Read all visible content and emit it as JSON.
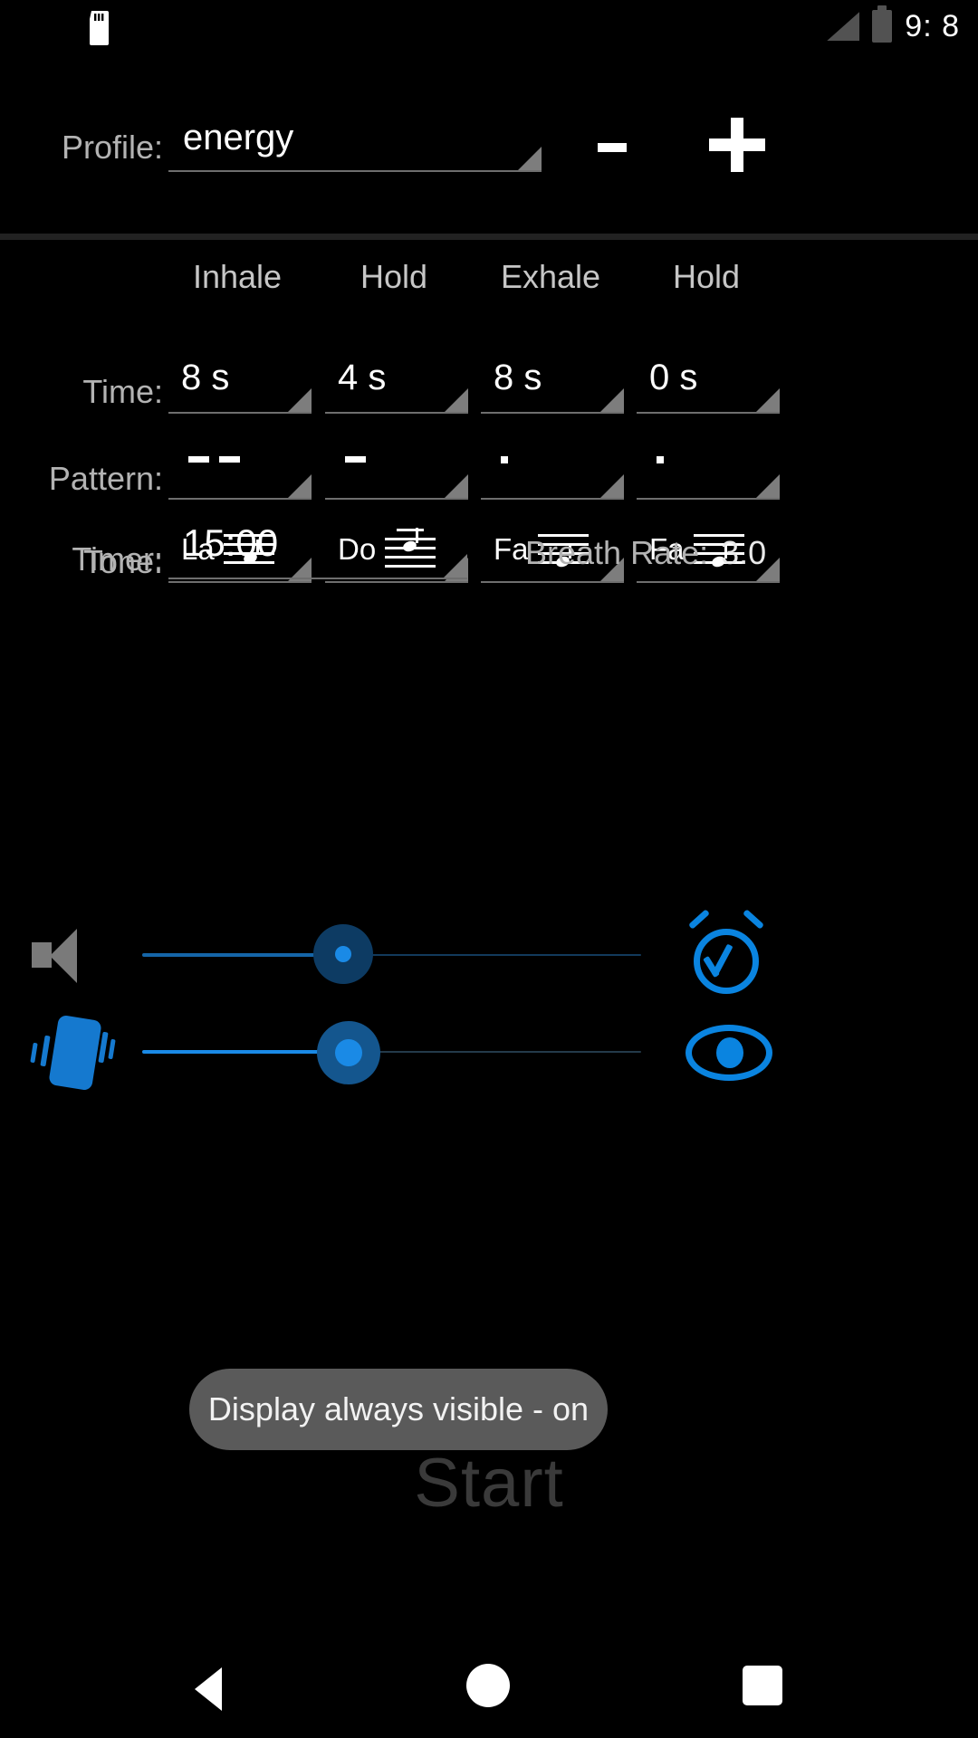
{
  "status_bar": {
    "sd_card_icon": "sd-card-icon",
    "signal_icon": "signal-bars-icon",
    "battery_icon": "battery-icon",
    "time": "9: 8"
  },
  "profile": {
    "label": "Profile:",
    "value": "energy",
    "dropdown_icon": "spinner-caret-icon",
    "minus_label": "−",
    "plus_label": "+",
    "minus_name": "remove-profile-button",
    "plus_name": "add-profile-button"
  },
  "table": {
    "columns": [
      "Inhale",
      "Hold",
      "Exhale",
      "Hold"
    ],
    "rows": [
      {
        "label": "Time:",
        "values": [
          "8 s",
          "4 s",
          "8 s",
          "0 s"
        ]
      },
      {
        "label": "Pattern:",
        "values": [
          "- -",
          "-",
          ".",
          "."
        ]
      },
      {
        "label": "Tone:",
        "values": [
          "La",
          "Do",
          "Fa",
          "Fa"
        ]
      }
    ]
  },
  "timer": {
    "label": "Timer:",
    "value": "15:00"
  },
  "breath_rate": {
    "label": "Breath Rate:",
    "value": "3.0"
  },
  "controls": {
    "volume": {
      "icon": "speaker-muted-icon",
      "slider_name": "volume-slider",
      "percent": 38,
      "end_icon": "alarm-check-icon",
      "end_icon_name": "alarm-toggle-button"
    },
    "vibration": {
      "icon": "vibration-icon",
      "slider_name": "vibration-slider",
      "percent": 41,
      "end_icon": "eye-icon",
      "end_icon_name": "display-always-visible-button"
    }
  },
  "start_button": {
    "label": "Start"
  },
  "toast": {
    "message": "Display always visible - on"
  },
  "nav_bar": {
    "back": "back-triangle-icon",
    "home": "home-circle-icon",
    "recents": "recents-square-icon"
  },
  "colors": {
    "accent": "#0a84e0",
    "background": "#000000",
    "muted_text": "#b3b3b3",
    "toast_bg": "#5a5a5a"
  }
}
